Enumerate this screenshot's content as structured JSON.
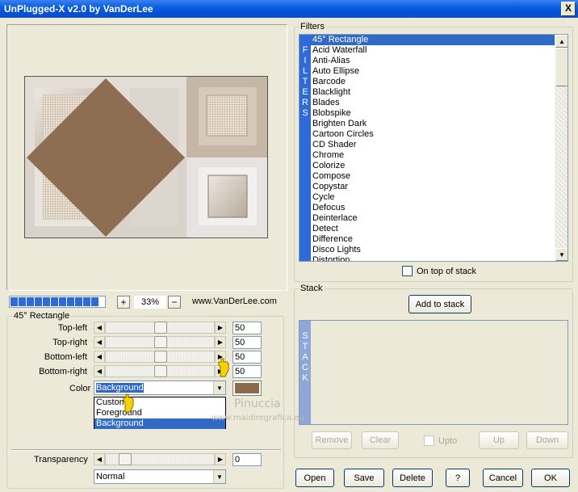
{
  "window": {
    "title": "UnPlugged-X v2.0 by VanDerLee",
    "close_label": "X"
  },
  "preview": {
    "zoom": "33%",
    "zoom_in": "+",
    "zoom_out": "−",
    "website": "www.VanDerLee.com",
    "progress_segments": 11
  },
  "params": {
    "group_label": "45° Rectangle",
    "sliders": [
      {
        "label": "Top-left",
        "value": "50"
      },
      {
        "label": "Top-right",
        "value": "50"
      },
      {
        "label": "Bottom-left",
        "value": "50"
      },
      {
        "label": "Bottom-right",
        "value": "50"
      }
    ],
    "color_label": "Color",
    "color_value": "Background",
    "color_swatch": "#8a6a4c",
    "color_options": [
      "Custom",
      "Foreground",
      "Background"
    ],
    "transparency_label": "Transparency",
    "transparency_value": "0",
    "blend_mode": "Normal"
  },
  "filters": {
    "group_label": "Filters",
    "strip_letters": "FILTERS",
    "items": [
      "45° Rectangle",
      "Acid Waterfall",
      "Anti-Alias",
      "Auto Ellipse",
      "Barcode",
      "Blacklight",
      "Blades",
      "Blobspike",
      "Brighten Dark",
      "Cartoon Circles",
      "CD Shader",
      "Chrome",
      "Colorize",
      "Compose",
      "Copystar",
      "Cycle",
      "Defocus",
      "Deinterlace",
      "Detect",
      "Difference",
      "Disco Lights",
      "Distortion"
    ],
    "selected_index": 0,
    "on_top_label": "On top of stack"
  },
  "stack": {
    "group_label": "Stack",
    "add_label": "Add to stack",
    "strip_letters": "STACK",
    "remove_label": "Remove",
    "clear_label": "Clear",
    "upto_label": "Upto",
    "up_label": "Up",
    "down_label": "Down"
  },
  "footer": {
    "open": "Open",
    "save": "Save",
    "delete": "Delete",
    "help": "?",
    "cancel": "Cancel",
    "ok": "OK"
  },
  "watermark": {
    "name": "Pinuccia",
    "url": "www.maidiregrafica.eu"
  },
  "colors": {
    "title_bar": "#0a5fe0",
    "selection": "#316ac5",
    "strip": "#2f6bd8"
  }
}
